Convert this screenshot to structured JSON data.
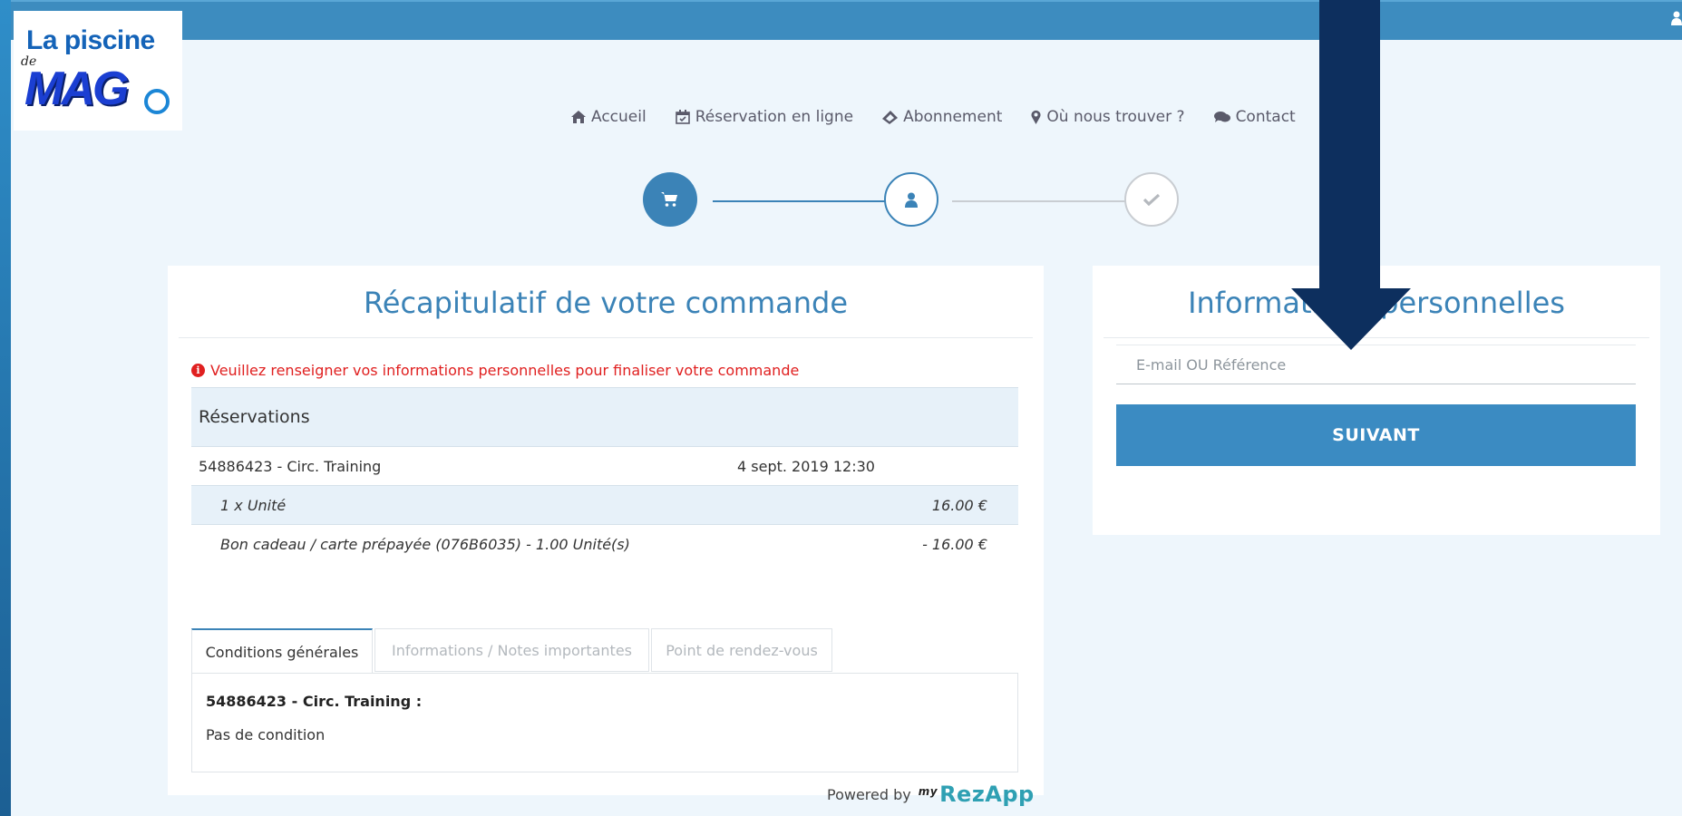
{
  "logo": {
    "line1": "La piscine",
    "line2": "MAG",
    "small": "de"
  },
  "nav": {
    "items": [
      {
        "label": "Accueil",
        "icon": "home-icon"
      },
      {
        "label": "Réservation en ligne",
        "icon": "calendar-check-icon"
      },
      {
        "label": "Abonnement",
        "icon": "ticket-icon"
      },
      {
        "label": "Où nous trouver ?",
        "icon": "map-marker-icon"
      },
      {
        "label": "Contact",
        "icon": "comments-icon"
      }
    ]
  },
  "stepper": {
    "steps": [
      {
        "icon": "cart-icon",
        "state": "done"
      },
      {
        "icon": "user-icon",
        "state": "current"
      },
      {
        "icon": "check-icon",
        "state": "pending"
      }
    ]
  },
  "summary": {
    "title": "Récapitulatif de votre commande",
    "alert": "Veuillez renseigner vos informations personnelles pour finaliser votre commande",
    "table_header": "Réservations",
    "rows": {
      "main": {
        "label": "54886423 - Circ. Training",
        "date": "4 sept. 2019 12:30"
      },
      "unit": {
        "label": "1 x Unité",
        "amount": "16.00 €"
      },
      "gift": {
        "label": "Bon cadeau / carte prépayée (076B6035) - 1.00 Unité(s)",
        "amount": "- 16.00 €"
      }
    },
    "tabs": [
      "Conditions générales",
      "Informations / Notes importantes",
      "Point de rendez-vous"
    ],
    "active_tab": 0,
    "conditions": {
      "title": "54886423 - Circ. Training :",
      "text": "Pas de condition"
    }
  },
  "personal": {
    "title": "Informations personnelles",
    "input_placeholder": "E-mail OU Référence",
    "input_value": "",
    "next_label": "SUIVANT"
  },
  "footer": {
    "powered_by": "Powered by",
    "brand_prefix": "my",
    "brand": "RezApp"
  },
  "colors": {
    "accent": "#3b83b7",
    "alert": "#e02020",
    "arrow": "#0d2f5e",
    "topbar": "#3d8cbf"
  }
}
